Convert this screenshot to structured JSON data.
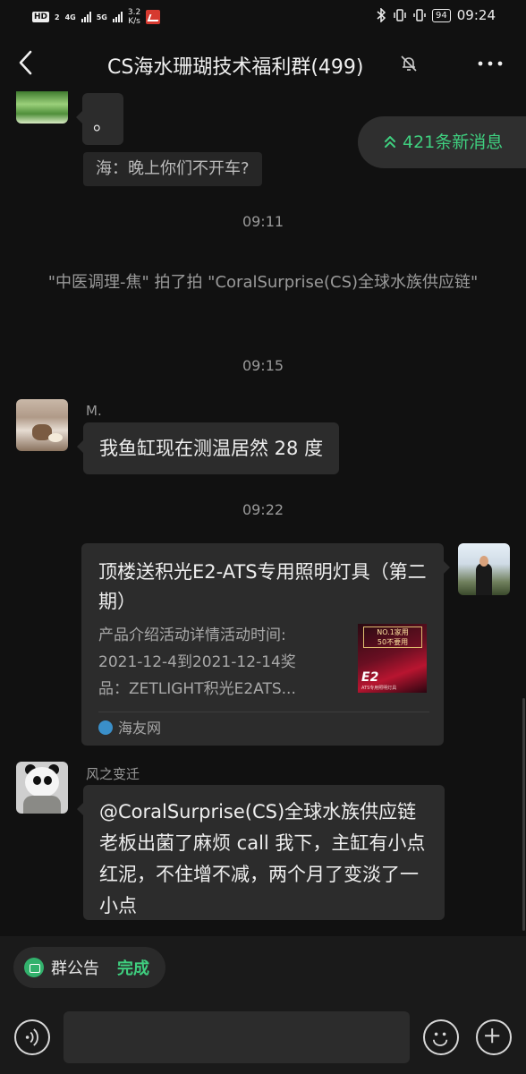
{
  "status_bar": {
    "hd": "HD",
    "sim": "2",
    "net1": "4G",
    "net2": "5G",
    "speed_value": "3.2",
    "speed_unit": "K/s",
    "battery": "94",
    "time": "09:24"
  },
  "header": {
    "title": "CS海水珊瑚技术福利群(499)"
  },
  "new_messages": "421条新消息",
  "messages": {
    "dot_text": "。",
    "quote_text": "海：晚上你们不开车?",
    "time_1": "09:11",
    "pat_text": "\"中医调理-焦\" 拍了拍 \"CoralSurprise(CS)全球水族供应链\"",
    "time_2": "09:15",
    "m_sender": "M.",
    "m_text": "我鱼缸现在测温居然 28 度",
    "time_3": "09:22",
    "card": {
      "title": "顶楼送积光E2-ATS专用照明灯具（第二期）",
      "desc_line1": "产品介绍活动详情活动时间:",
      "desc_line2": "2021-12-4到2021-12-14奖",
      "desc_line3": "品：ZETLIGHT积光E2ATS...",
      "thumb_badge_1": "NO.1家用",
      "thumb_badge_2": "50不要用",
      "thumb_e2": "E2",
      "thumb_sub": "ATS专用照明灯具",
      "source": "海友网"
    },
    "wind_sender": "风之变迁",
    "wind_text": "@CoralSurprise(CS)全球水族供应链  老板出菌了麻烦 call 我下，主缸有小点红泥，不住增不减，两个月了变淡了一小点"
  },
  "bottom": {
    "announcement": "群公告",
    "done": "完成",
    "input_value": ""
  },
  "colors": {
    "background": "#111111",
    "bubble": "#2c2c2c",
    "accent_green": "#3fcf7f"
  }
}
